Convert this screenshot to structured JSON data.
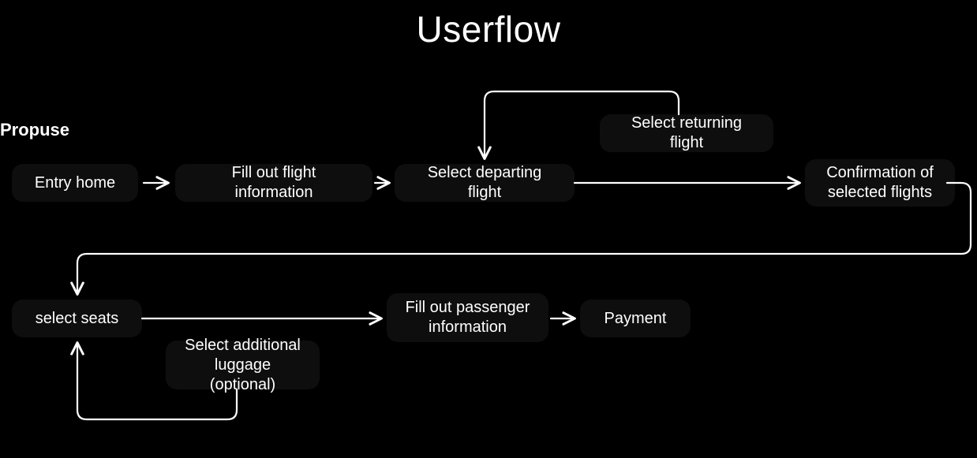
{
  "title": "Userflow",
  "section_label": "Propuse",
  "nodes": {
    "entry_home": "Entry home",
    "fill_flight_info": "Fill out flight information",
    "select_departing": "Select departing  flight",
    "select_returning": "Select returning flight",
    "confirmation": "Confirmation of\nselected flights",
    "select_seats": "select seats",
    "select_luggage": "Select  additional\nluggage (optional)",
    "fill_passenger": "Fill out passenger\ninformation",
    "payment": "Payment"
  }
}
